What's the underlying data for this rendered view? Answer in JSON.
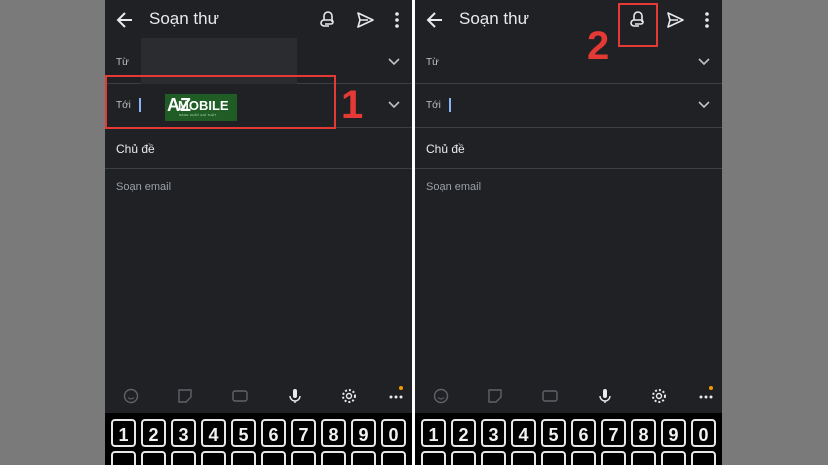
{
  "left_screen": {
    "header": {
      "title": "Soạn thư"
    },
    "from_label": "Từ",
    "to_label": "Tới",
    "subject_label": "Chủ đề",
    "body_placeholder": "Soạn email"
  },
  "right_screen": {
    "header": {
      "title": "Soạn thư"
    },
    "from_label": "Từ",
    "to_label": "Tới",
    "subject_label": "Chủ đề",
    "body_placeholder": "Soạn email"
  },
  "keyboard": {
    "number_keys": [
      "1",
      "2",
      "3",
      "4",
      "5",
      "6",
      "7",
      "8",
      "9",
      "0"
    ],
    "toolbar_icons": [
      "emoji-icon",
      "sticker-icon",
      "gif-icon",
      "mic-icon",
      "gear-icon",
      "more-icon"
    ]
  },
  "annotations": {
    "step1": "1",
    "step2": "2",
    "highlight_color": "#e53935"
  },
  "logo": {
    "brand": "MOBILE",
    "letter": "AZ",
    "tagline": "SÀNG CHẤT GIÁ THẬT"
  },
  "colors": {
    "background": "#202124",
    "text": "#e8eaed",
    "cursor": "#8ab4f8",
    "accent_dot": "#f29900"
  }
}
